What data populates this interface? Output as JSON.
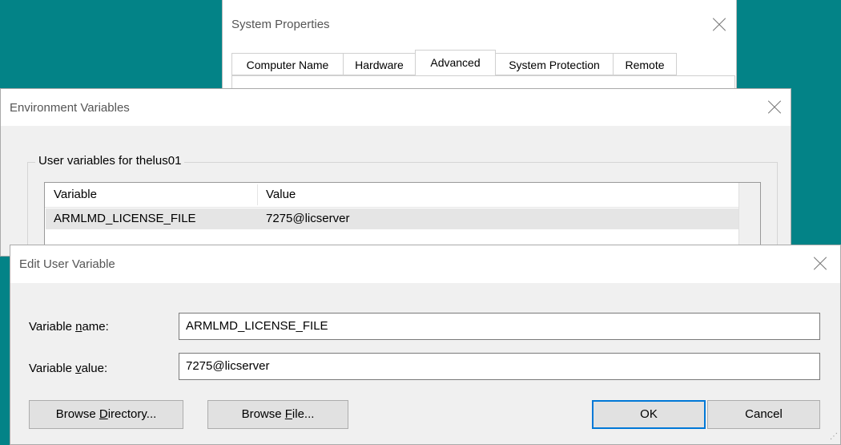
{
  "system_properties": {
    "title": "System Properties",
    "tabs": [
      {
        "label": "Computer Name"
      },
      {
        "label": "Hardware"
      },
      {
        "label": "Advanced",
        "active": true
      },
      {
        "label": "System Protection"
      },
      {
        "label": "Remote"
      }
    ]
  },
  "environment_variables": {
    "title": "Environment Variables",
    "user_group_label": "User variables for thelus01",
    "columns": [
      "Variable",
      "Value"
    ],
    "rows": [
      {
        "variable": "ARMLMD_LICENSE_FILE",
        "value": "7275@licserver",
        "selected": true
      }
    ]
  },
  "edit_user_variable": {
    "title": "Edit User Variable",
    "name_label_pre": "Variable ",
    "name_label_key": "n",
    "name_label_post": "ame:",
    "value_label_pre": "Variable ",
    "value_label_key": "v",
    "value_label_post": "alue:",
    "name_value": "ARMLMD_LICENSE_FILE",
    "value_value": "7275@licserver",
    "buttons": {
      "browse_directory": {
        "pre": "Browse ",
        "key": "D",
        "post": "irectory..."
      },
      "browse_file": {
        "pre": "Browse ",
        "key": "F",
        "post": "ile..."
      },
      "ok": "OK",
      "cancel": "Cancel"
    }
  },
  "colors": {
    "desktop": "#038387",
    "dialog_bg": "#f0f0f0",
    "selection": "#e5e5e5"
  }
}
